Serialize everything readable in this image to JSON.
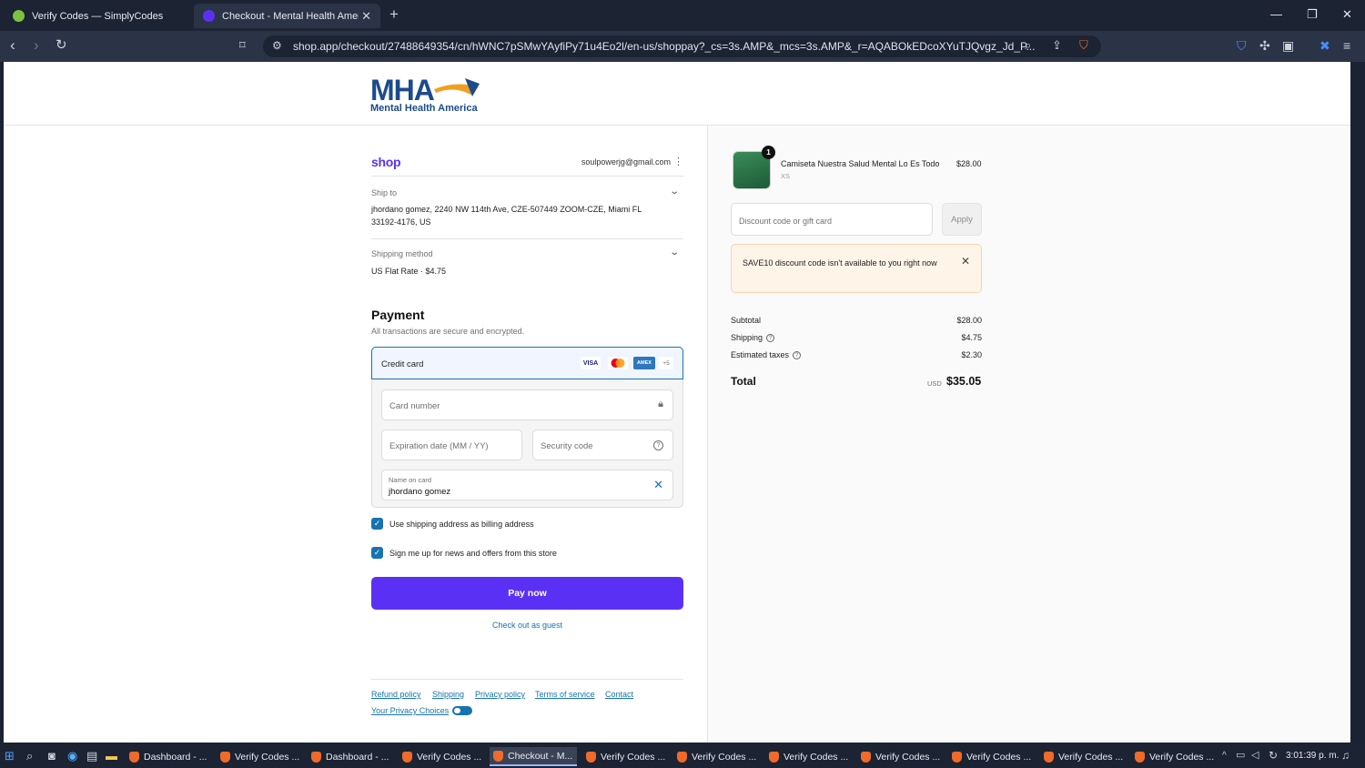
{
  "browser": {
    "tabs": [
      {
        "title": "Verify Codes — SimplyCodes",
        "active": false
      },
      {
        "title": "Checkout - Mental Health Ameri",
        "active": true
      }
    ],
    "url": "shop.app/checkout/27488649354/cn/hWNC7pSMwYAyfiPy71u4Eo2l/en-us/shoppay?_cs=3s.AMP&_mcs=3s.AMP&_r=AQABOkEDcoXYuTJQvgz_Jd_P..."
  },
  "header": {
    "logo_text": "MHA",
    "logo_sub": "Mental Health America"
  },
  "shop": {
    "brand": "shop",
    "email": "soulpowerjg@gmail.com"
  },
  "ship_to": {
    "label": "Ship to",
    "line1": "jhordano gomez, 2240 NW 114th Ave, CZE-507449 ZOOM-CZE, Miami FL",
    "line2": "33192-4176, US"
  },
  "shipping_method": {
    "label": "Shipping method",
    "value": "US Flat Rate · $4.75"
  },
  "payment": {
    "title": "Payment",
    "subtitle": "All transactions are secure and encrypted.",
    "method_label": "Credit card",
    "brands": [
      "VISA",
      "AMEX",
      "+5"
    ],
    "card_number_placeholder": "Card number",
    "expiration_placeholder": "Expiration date (MM / YY)",
    "security_placeholder": "Security code",
    "name_label": "Name on card",
    "name_value": "jhordano gomez",
    "billing_check": "Use shipping address as billing address",
    "news_check": "Sign me up for news and offers from this store",
    "pay_button": "Pay now",
    "guest_link": "Check out as guest"
  },
  "footer": {
    "links": [
      "Refund policy",
      "Shipping",
      "Privacy policy",
      "Terms of service",
      "Contact"
    ],
    "privacy_choices": "Your Privacy Choices"
  },
  "order": {
    "quantity": "1",
    "product_name": "Camiseta Nuestra Salud Mental Lo Es Todo",
    "variant": "XS",
    "price": "$28.00",
    "discount_placeholder": "Discount code or gift card",
    "apply_label": "Apply",
    "alert_text": "SAVE10 discount code isn't available to you right now",
    "subtotal_label": "Subtotal",
    "subtotal": "$28.00",
    "shipping_label": "Shipping",
    "shipping": "$4.75",
    "taxes_label": "Estimated taxes",
    "taxes": "$2.30",
    "total_label": "Total",
    "currency": "USD",
    "total": "$35.05"
  },
  "taskbar": {
    "items": [
      "Dashboard - ...",
      "Verify Codes ...",
      "Dashboard - ...",
      "Verify Codes ...",
      "Checkout - M...",
      "Verify Codes ...",
      "Verify Codes ...",
      "Verify Codes ...",
      "Verify Codes ...",
      "Verify Codes ...",
      "Verify Codes ...",
      "Verify Codes ..."
    ],
    "clock": "3:01:39 p. m."
  },
  "colors": {
    "shop_purple": "#5a31f4",
    "link_blue": "#1773b0",
    "alert_bg": "#fff4e8"
  }
}
